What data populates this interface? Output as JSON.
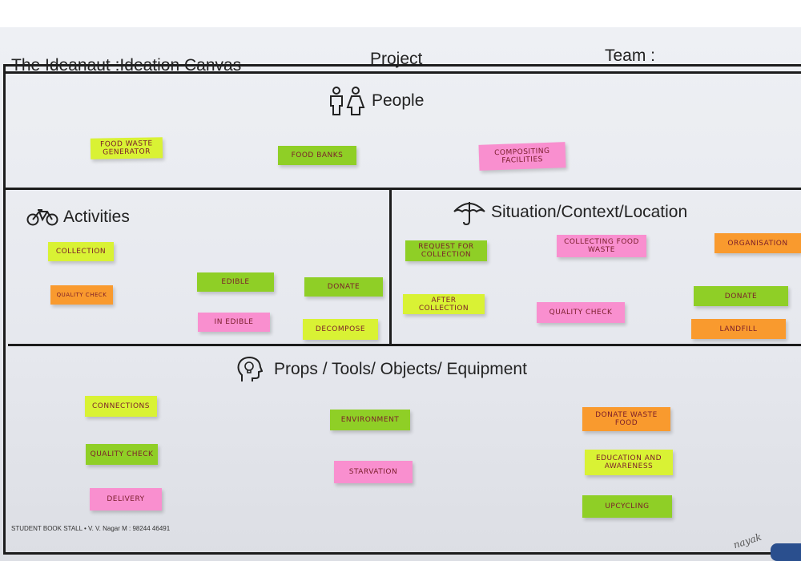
{
  "header": {
    "title": "The Ideanaut :Ideation Canvas",
    "project": "Project",
    "team": "Team :"
  },
  "sections": {
    "people": "People",
    "activities": "Activities",
    "situation": "Situation/Context/Location",
    "props": "Props  /  Tools/  Objects/  Equipment"
  },
  "notes": {
    "people": [
      "FOOD WASTE GENERATOR",
      "FOOD BANKS",
      "COMPOSITING FACILITIES"
    ],
    "activities": [
      "COLLECTION",
      "QUALITY CHECK",
      "EDIBLE",
      "IN EDIBLE",
      "DONATE",
      "DECOMPOSE"
    ],
    "situation": [
      "REQUEST FOR COLLECTION",
      "AFTER COLLECTION",
      "COLLECTING FOOD WASTE",
      "QUALITY CHECK",
      "ORGANISATION",
      "DONATE",
      "LANDFILL"
    ],
    "props": [
      "CONNECTIONS",
      "QUALITY CHECK",
      "DELIVERY",
      "ENVIRONMENT",
      "STARVATION",
      "DONATE WASTE FOOD",
      "EDUCATION AND AWARENESS",
      "UPCYCLING"
    ]
  },
  "footer": "STUDENT BOOK STALL • V. V. Nagar M : 98244 46491",
  "signature": "nayak",
  "colors": {
    "yellow_green": "#d9f234",
    "green": "#8fcf26",
    "pink": "#f98fcf",
    "orange": "#f99a2e",
    "ink": "#7a1d2a",
    "frame": "#1c1c1c"
  },
  "icons": [
    "people-icon",
    "bicycle-icon",
    "umbrella-icon",
    "lightbulb-head-icon"
  ]
}
